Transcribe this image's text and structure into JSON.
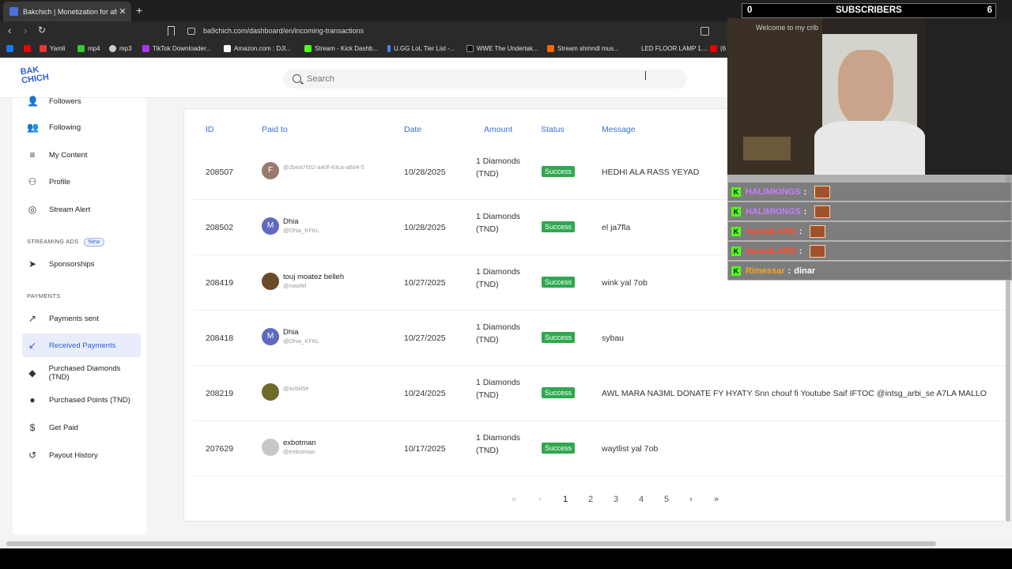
{
  "browser": {
    "tab_title": "Bakchich | Monetization for afric",
    "tab_close": "✕",
    "new_tab": "+",
    "url": "ba9chich.com/dashboard/en/incoming-transactions",
    "bookmarks": [
      "Yamli",
      "mp4",
      "mp3",
      "TikTok Downloader...",
      "Amazon.com : DJI...",
      "Stream - Kick Dashb...",
      "U.GG LoL Tier List -...",
      "WWE The Undertak...",
      "Stream shmndl mus...",
      "LED FLOOR LAMP 1....",
      "(6"
    ]
  },
  "logo": {
    "line1": "BAK",
    "line2": "CHICH"
  },
  "search": {
    "placeholder": "Search"
  },
  "sidebar": {
    "items": [
      {
        "label": "Followers",
        "icon": "followers-icon"
      },
      {
        "label": "Following",
        "icon": "following-icon"
      },
      {
        "label": "My Content",
        "icon": "content-icon"
      },
      {
        "label": "Profile",
        "icon": "profile-icon"
      },
      {
        "label": "Stream Alert",
        "icon": "stream-alert-icon"
      }
    ],
    "section_ads": "STREAMING ADS",
    "section_ads_badge": "New",
    "ads_items": [
      {
        "label": "Sponsorships",
        "icon": "sponsorships-icon"
      }
    ],
    "section_payments": "PAYMENTS",
    "payment_items": [
      {
        "label": "Payments sent",
        "icon": "payments-sent-icon"
      },
      {
        "label": "Received Payments",
        "icon": "received-payments-icon",
        "active": true
      },
      {
        "label": "Purchased Diamonds (TND)",
        "icon": "diamond-icon"
      },
      {
        "label": "Purchased Points (TND)",
        "icon": "points-icon"
      },
      {
        "label": "Get Paid",
        "icon": "dollar-icon"
      },
      {
        "label": "Payout History",
        "icon": "history-icon"
      }
    ]
  },
  "table": {
    "headers": {
      "id": "ID",
      "paid_to": "Paid to",
      "date": "Date",
      "amount": "Amount",
      "status": "Status",
      "message": "Message"
    },
    "rows": [
      {
        "id": "208507",
        "avatar_letter": "F",
        "avatar_color": "#9b7a6e",
        "name": "",
        "handle": "@2bea7652-a40f-43ca-a8d4-5",
        "date": "10/28/2025",
        "amount": "1 Diamonds (TND)",
        "status": "Success",
        "message": "HEDHI ALA RASS YEYAD"
      },
      {
        "id": "208502",
        "avatar_letter": "M",
        "avatar_color": "#5d6bc0",
        "name": "Dhia",
        "handle": "@Dhia_KFKL",
        "date": "10/28/2025",
        "amount": "1 Diamonds (TND)",
        "status": "Success",
        "message": "el ja7fla"
      },
      {
        "id": "208419",
        "avatar_letter": "",
        "avatar_color": "#6b4a2a",
        "name": "touj moatez belleh",
        "handle": "@nawfel",
        "date": "10/27/2025",
        "amount": "1 Diamonds (TND)",
        "status": "Success",
        "message": "wink yal 7ob"
      },
      {
        "id": "208418",
        "avatar_letter": "M",
        "avatar_color": "#5d6bc0",
        "name": "Dhia",
        "handle": "@Dhia_KFKL",
        "date": "10/27/2025",
        "amount": "1 Diamonds (TND)",
        "status": "Success",
        "message": "sybau"
      },
      {
        "id": "208219",
        "avatar_letter": "",
        "avatar_color": "#6e6a2a",
        "name": "",
        "handle": "@Arbiii5e",
        "date": "10/24/2025",
        "amount": "1 Diamonds (TND)",
        "status": "Success",
        "message": "AWL MARA NA3ML DONATE FY HYATY Snn chouf fi Youtube Saif IFTOC @intsg_arbi_se A7LA MALLO"
      },
      {
        "id": "207629",
        "avatar_letter": "",
        "avatar_color": "#c8c8c8",
        "name": "exbotman",
        "handle": "@exbotman",
        "date": "10/17/2025",
        "amount": "1 Diamonds (TND)",
        "status": "Success",
        "message": "waytlist yal 7ob"
      }
    ]
  },
  "pagination": {
    "first": "«",
    "prev": "‹",
    "pages": [
      "1",
      "2",
      "3",
      "4",
      "5"
    ],
    "current": "1",
    "next": "›",
    "last": "»"
  },
  "overlay": {
    "subs_left": "0",
    "subs_title": "SUBSCRIBERS",
    "subs_right": "6",
    "cam_text": "Welcome to my crib",
    "chat": [
      {
        "user": "HALIMKINGS",
        "sep": ":",
        "text": "",
        "color": "#c77dff"
      },
      {
        "user": "HALIMKINGS",
        "sep": ":",
        "text": "",
        "color": "#c77dff"
      },
      {
        "user": "AyoubLXRD",
        "sep": ":",
        "text": "",
        "color": "#ff4b2b"
      },
      {
        "user": "AyoubLXRD",
        "sep": ":",
        "text": "",
        "color": "#ff4b2b"
      },
      {
        "user": "Rimessar",
        "sep": ":",
        "text": "dinar",
        "color": "#f5a623"
      }
    ]
  },
  "colors": {
    "accent": "#2b5fd9",
    "success": "#2fa84f",
    "kick_green": "#53fc18"
  }
}
